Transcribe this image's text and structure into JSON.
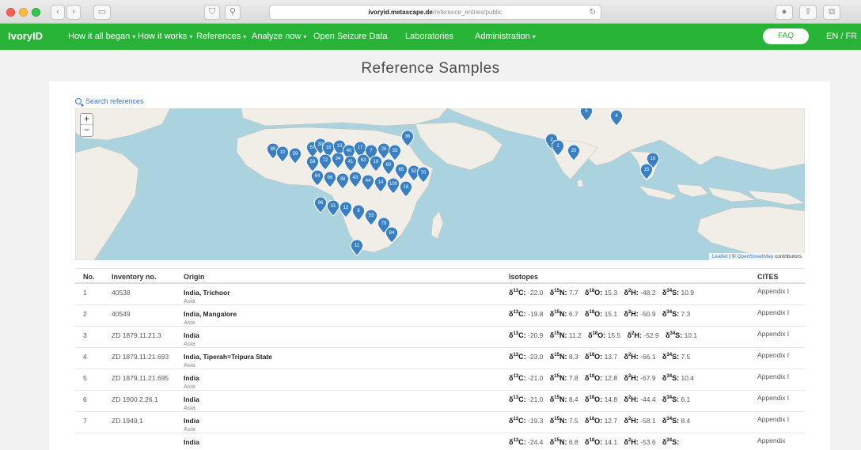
{
  "browser": {
    "url_host": "ivoryid.metascape.de",
    "url_path": "/reference_entries/public"
  },
  "navbar": {
    "brand": "IvoryID",
    "items": [
      {
        "label": "How it all began",
        "dropdown": true
      },
      {
        "label": "How it works",
        "dropdown": true
      },
      {
        "label": "References",
        "dropdown": true
      },
      {
        "label": "Analyze now",
        "dropdown": true
      },
      {
        "label": "Open Seizure Data",
        "dropdown": false
      },
      {
        "label": "Laboratories",
        "dropdown": false
      },
      {
        "label": "Administration",
        "dropdown": true
      }
    ],
    "faq": "FAQ",
    "lang": "EN / FR"
  },
  "page": {
    "title": "Reference Samples",
    "search_link": "Search references"
  },
  "map": {
    "zoom_in": "+",
    "zoom_out": "−",
    "attribution_leaflet": "Leaflet",
    "attribution_sep": " | © ",
    "attribution_osm": "OpenStreetMap",
    "attribution_rest": " contributors",
    "markers": [
      "5",
      "4",
      "2",
      "1",
      "20",
      "16",
      "15",
      "36",
      "89",
      "10",
      "59",
      "67",
      "30",
      "18",
      "13",
      "40",
      "17",
      "7",
      "26",
      "33",
      "58",
      "72",
      "34",
      "41",
      "63",
      "19",
      "60",
      "65",
      "52",
      "70",
      "64",
      "66",
      "38",
      "43",
      "44",
      "14",
      "100",
      "18",
      "96",
      "31",
      "12",
      "8",
      "53",
      "79",
      "84",
      "11"
    ]
  },
  "colors": {
    "navbar": "#27b436",
    "marker": "#3a7fc1",
    "link": "#3a77c2",
    "water": "#aad3df",
    "land": "#f1eee8"
  },
  "table": {
    "columns": [
      "No.",
      "Inventory no.",
      "Origin",
      "Isotopes",
      "CITES"
    ],
    "iso_labels": {
      "c": "C",
      "n": "N",
      "o": "O",
      "h": "H",
      "s": "S"
    },
    "rows": [
      {
        "no": "1",
        "inv": "40538",
        "origin": "India, Trichoor",
        "region": "Asia",
        "c": "-22.0",
        "n": "7.7",
        "o": "15.3",
        "h": "-48.2",
        "s": "10.9",
        "cites": "Appendix I"
      },
      {
        "no": "2",
        "inv": "40549",
        "origin": "India, Mangalore",
        "region": "Asia",
        "c": "-19.8",
        "n": "6.7",
        "o": "15.1",
        "h": "-50.9",
        "s": "7.3",
        "cites": "Appendix I"
      },
      {
        "no": "3",
        "inv": "ZD 1879.11.21.3",
        "origin": "India",
        "region": "Asia",
        "c": "-20.9",
        "n": "11.2",
        "o": "15.5",
        "h": "-52.9",
        "s": "10.1",
        "cites": "Appendix I"
      },
      {
        "no": "4",
        "inv": "ZD 1879.11.21.693",
        "origin": "India, Tiperah=Tripura State",
        "region": "Asia",
        "c": "-23.0",
        "n": "8.3",
        "o": "13.7",
        "h": "-66.1",
        "s": "7.5",
        "cites": "Appendix I"
      },
      {
        "no": "5",
        "inv": "ZD 1879.11.21.695",
        "origin": "India",
        "region": "Asia",
        "c": "-21.0",
        "n": "7.8",
        "o": "12.8",
        "h": "-67.9",
        "s": "10.4",
        "cites": "Appendix I"
      },
      {
        "no": "6",
        "inv": "ZD 1900.2.26.1",
        "origin": "India",
        "region": "Asia",
        "c": "-21.0",
        "n": "8.4",
        "o": "14.8",
        "h": "-44.4",
        "s": "6.1",
        "cites": "Appendix I"
      },
      {
        "no": "7",
        "inv": "ZD 1949,1",
        "origin": "India",
        "region": "Asia",
        "c": "-19.3",
        "n": "7.5",
        "o": "12.7",
        "h": "-58.1",
        "s": "8.4",
        "cites": "Appendix I"
      },
      {
        "no": "",
        "inv": "",
        "origin": "India",
        "region": "",
        "c": "-24.4",
        "n": "6.8",
        "o": "14.1",
        "h": "-53.6",
        "s": "",
        "cites": "Appendix"
      }
    ]
  }
}
